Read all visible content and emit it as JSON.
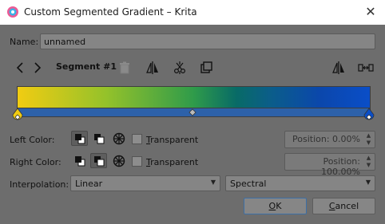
{
  "window": {
    "title": "Custom Segmented Gradient – Krita",
    "close_glyph": "✕",
    "app_icon": "krita-logo-icon"
  },
  "name": {
    "label": "Name:",
    "value": "unnamed"
  },
  "toolbar": {
    "segment_label": "Segment #1",
    "icons": [
      "arrow-left-icon",
      "arrow-right-icon",
      "trash-icon",
      "flip-segment-icon",
      "split-segment-icon",
      "duplicate-segment-icon",
      "flip-gradient-icon",
      "distribute-handles-icon"
    ]
  },
  "gradient": {
    "start_color": "#f1cc12",
    "end_color": "#0a4ec8",
    "midpoint_fraction": 0.5
  },
  "left_color": {
    "label": "Left Color:",
    "transparent_label_pre": "",
    "transparent_underlined": "T",
    "transparent_label_post": "ransparent",
    "transparent_checked": false,
    "position_text": "Position: 0.00%"
  },
  "right_color": {
    "label": "Right Color:",
    "transparent_label_pre": "",
    "transparent_underlined": "T",
    "transparent_label_post": "ransparent",
    "transparent_checked": false,
    "position_text": "Position: 100.00%"
  },
  "interpolation": {
    "label": "Interpolation:",
    "value": "Linear",
    "color_mode": "Spectral"
  },
  "buttons": {
    "ok_underlined": "O",
    "ok_rest": "K",
    "cancel_underlined": "C",
    "cancel_rest": "ancel"
  }
}
